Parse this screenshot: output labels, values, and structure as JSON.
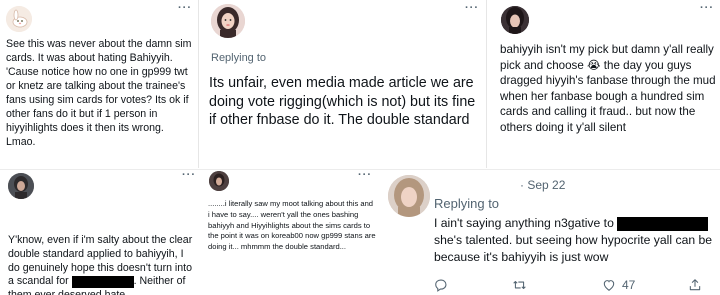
{
  "tweets": [
    {
      "more": "···",
      "text": "See this was never about the damn sim cards. It was about hating Bahiyyih. 'Cause notice how no one in gp999 twt or knetz are talking about the trainee's fans using sim cards for votes? Its ok if other fans do it but if 1 person in hiyyihlights does it then its wrong. Lmao."
    },
    {
      "more": "···",
      "reply_label": "Replying to",
      "text": "Its unfair, even media made article we are doing vote rigging(which is not) but its fine if other fnbase do it. The double standard"
    },
    {
      "more": "···",
      "text_a": "bahiyyih isn't my pick but damn y'all really pick and choose",
      "emoji": "😭",
      "text_b": " the day you guys dragged hiyyih's fanbase through the mud when her fanbase bough a hundred sim cards and calling it fraud.. but now the others doing it y'all silent"
    },
    {
      "more": "···",
      "text_a": "Y'know, even if i'm salty about the clear double standard applied to bahiyyih, I do genuinely hope this doesn't turn into a scandal for",
      "text_b": ". Neither of them ever deserved hate."
    },
    {
      "more": "···",
      "text": "........i literally saw my moot talking about this and i have to say.... weren't yall the ones bashing bahiyyh and Hiyyihlights about the sims cards to the point it was on koreab00 now gp999 stans are doing it... mhmmm the double standard..."
    },
    {
      "reply_label": "Replying to",
      "date": "· Sep 22",
      "text_a": "I ain't saying anything n3gative to",
      "text_b": "she's talented. but seeing how hypocrite yall can be because it's bahiyyih is just wow",
      "actions": {
        "like_count": "47"
      }
    }
  ],
  "icons": [
    "comment-icon",
    "retweet-icon",
    "like-icon",
    "share-icon"
  ],
  "colors": {
    "text": "#0f1419",
    "muted": "#536471",
    "redaction": "#000000"
  }
}
